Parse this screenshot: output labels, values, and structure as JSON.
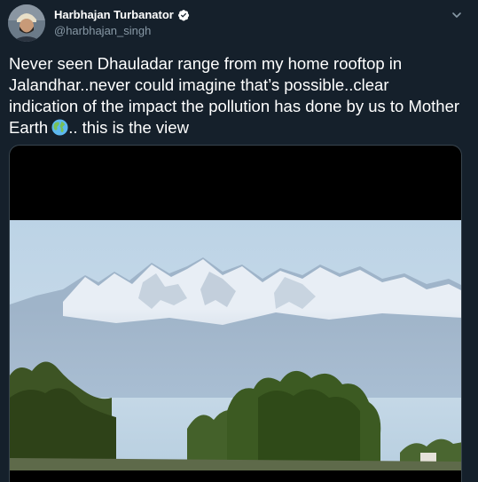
{
  "tweet": {
    "display_name": "Harbhajan Turbanator",
    "handle": "@harbhajan_singh",
    "text_main": "Never seen Dhauladar range from my home rooftop in Jalandhar..never could imagine that’s possible..clear indication of the impact the pollution has done by us to Mother Earth",
    "text_tail": ".. this is the view",
    "verified": true,
    "icons": {
      "verified": "verified-badge-icon",
      "caret": "chevron-down-icon",
      "emoji": "globe-earth-icon"
    },
    "colors": {
      "background": "#15202b",
      "text": "#ffffff",
      "secondary_text": "#8899a6",
      "border": "#38444d",
      "verified_blue": "#1da1f2"
    }
  }
}
